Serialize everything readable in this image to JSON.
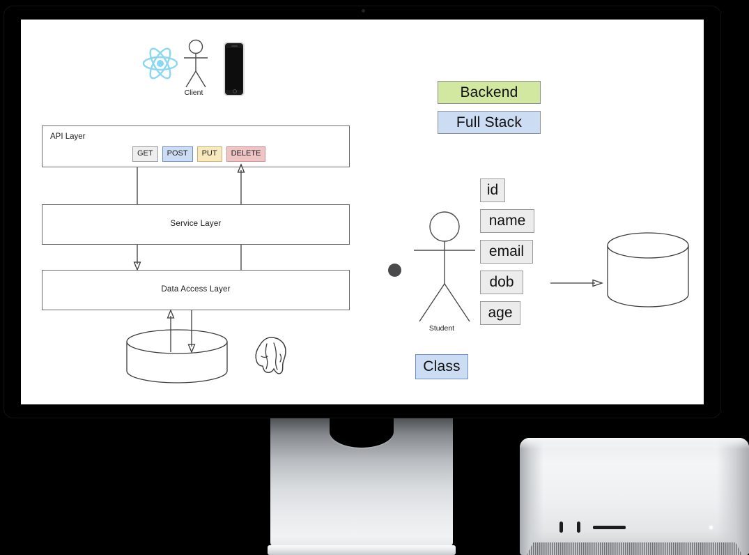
{
  "device": {
    "display_name": "studio-display",
    "camera": "camera-dot",
    "stand": "monitor-stand",
    "computer": "mac-studio",
    "mac_studio_ports": [
      "usb-c-port",
      "usb-c-port",
      "sd-card-slot"
    ],
    "mac_studio_led": "power-led"
  },
  "whiteboard": {
    "client": {
      "react_logo": "react-logo",
      "figure_label": "Client",
      "phone": "smartphone-device"
    },
    "api_layer": {
      "title": "API Layer",
      "methods": [
        {
          "label": "GET",
          "style": "get",
          "bg": "#eeeeee",
          "border": "#9a9a9a"
        },
        {
          "label": "POST",
          "style": "post",
          "bg": "#ccdcf2",
          "border": "#6d8fc4"
        },
        {
          "label": "PUT",
          "style": "put",
          "bg": "#f7e9bd",
          "border": "#cbb173"
        },
        {
          "label": "DELETE",
          "style": "delete",
          "bg": "#eec4c4",
          "border": "#c98f8f"
        }
      ]
    },
    "service_layer": {
      "title": "Service Layer"
    },
    "data_access_layer": {
      "title": "Data Access Layer"
    },
    "database_left": {
      "shape": "cylinder",
      "logo": "postgresql-elephant-logo",
      "logo_color": "#33618f"
    },
    "tags": [
      {
        "label": "Backend",
        "bg": "#d2e8a0",
        "border": "#8d8f92"
      },
      {
        "label": "Full Stack",
        "bg": "#ccdcf2",
        "border": "#8d8f92"
      }
    ],
    "entity": {
      "figure_label": "Student",
      "attributes": [
        "id",
        "name",
        "email",
        "dob",
        "age"
      ],
      "class_tag": {
        "label": "Class",
        "bg": "#ccdcf2",
        "border": "#6d8fc4"
      }
    },
    "database_right": {
      "shape": "cylinder"
    },
    "cursor": "mouse-cursor-dot"
  },
  "colors": {
    "ink": "#3b3b3b",
    "box_border": "#666a6e",
    "board_bg": "#ffffff",
    "bezel": "#000000",
    "react_blue": "#8ad7f2"
  }
}
